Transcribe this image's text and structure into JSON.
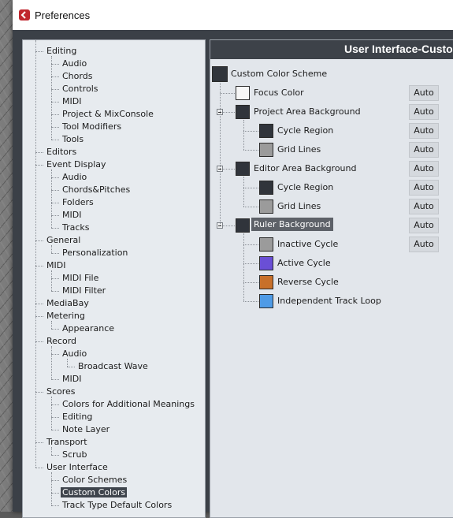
{
  "window": {
    "title": "Preferences"
  },
  "header": {
    "title": "User Interface-Custom Colors"
  },
  "tree": [
    {
      "label": "Editing",
      "depth": 0
    },
    {
      "label": "Audio",
      "depth": 1
    },
    {
      "label": "Chords",
      "depth": 1
    },
    {
      "label": "Controls",
      "depth": 1
    },
    {
      "label": "MIDI",
      "depth": 1
    },
    {
      "label": "Project & MixConsole",
      "depth": 1
    },
    {
      "label": "Tool Modifiers",
      "depth": 1
    },
    {
      "label": "Tools",
      "depth": 1
    },
    {
      "label": "Editors",
      "depth": 0
    },
    {
      "label": "Event Display",
      "depth": 0
    },
    {
      "label": "Audio",
      "depth": 1
    },
    {
      "label": "Chords&Pitches",
      "depth": 1
    },
    {
      "label": "Folders",
      "depth": 1
    },
    {
      "label": "MIDI",
      "depth": 1
    },
    {
      "label": "Tracks",
      "depth": 1
    },
    {
      "label": "General",
      "depth": 0
    },
    {
      "label": "Personalization",
      "depth": 1
    },
    {
      "label": "MIDI",
      "depth": 0
    },
    {
      "label": "MIDI File",
      "depth": 1
    },
    {
      "label": "MIDI Filter",
      "depth": 1
    },
    {
      "label": "MediaBay",
      "depth": 0
    },
    {
      "label": "Metering",
      "depth": 0
    },
    {
      "label": "Appearance",
      "depth": 1
    },
    {
      "label": "Record",
      "depth": 0
    },
    {
      "label": "Audio",
      "depth": 1
    },
    {
      "label": "Broadcast Wave",
      "depth": 2
    },
    {
      "label": "MIDI",
      "depth": 1
    },
    {
      "label": "Scores",
      "depth": 0
    },
    {
      "label": "Colors for Additional Meanings",
      "depth": 1
    },
    {
      "label": "Editing",
      "depth": 1
    },
    {
      "label": "Note Layer",
      "depth": 1
    },
    {
      "label": "Transport",
      "depth": 0
    },
    {
      "label": "Scrub",
      "depth": 1
    },
    {
      "label": "User Interface",
      "depth": 0
    },
    {
      "label": "Color Schemes",
      "depth": 1
    },
    {
      "label": "Custom Colors",
      "depth": 1,
      "selected": true
    },
    {
      "label": "Track Type Default Colors",
      "depth": 1
    }
  ],
  "colors": [
    {
      "label": "Custom Color Scheme",
      "level": 0,
      "swatch": "#30343b",
      "auto": null
    },
    {
      "label": "Focus Color",
      "level": 1,
      "swatch": "#f7f7f7",
      "auto": "Auto"
    },
    {
      "label": "Project Area Background",
      "level": 1,
      "swatch": "#30343b",
      "auto": "Auto",
      "expander": true
    },
    {
      "label": "Cycle Region",
      "level": 2,
      "swatch": "#30343b",
      "auto": "Auto"
    },
    {
      "label": "Grid Lines",
      "level": 2,
      "swatch": "#9b9b9b",
      "auto": "Auto"
    },
    {
      "label": "Editor Area Background",
      "level": 1,
      "swatch": "#30343b",
      "auto": "Auto",
      "expander": true
    },
    {
      "label": "Cycle Region",
      "level": 2,
      "swatch": "#30343b",
      "auto": "Auto"
    },
    {
      "label": "Grid Lines",
      "level": 2,
      "swatch": "#9b9b9b",
      "auto": "Auto"
    },
    {
      "label": "Ruler Background",
      "level": 1,
      "swatch": "#30343b",
      "auto": "Auto",
      "expander": true,
      "highlight": true
    },
    {
      "label": "Inactive Cycle",
      "level": 2,
      "swatch": "#9b9b9b",
      "auto": "Auto"
    },
    {
      "label": "Active Cycle",
      "level": 2,
      "swatch": "#6a4fd6",
      "auto": null
    },
    {
      "label": "Reverse Cycle",
      "level": 2,
      "swatch": "#c8702a",
      "auto": null
    },
    {
      "label": "Independent Track Loop",
      "level": 2,
      "swatch": "#4f9be6",
      "auto": null
    }
  ]
}
